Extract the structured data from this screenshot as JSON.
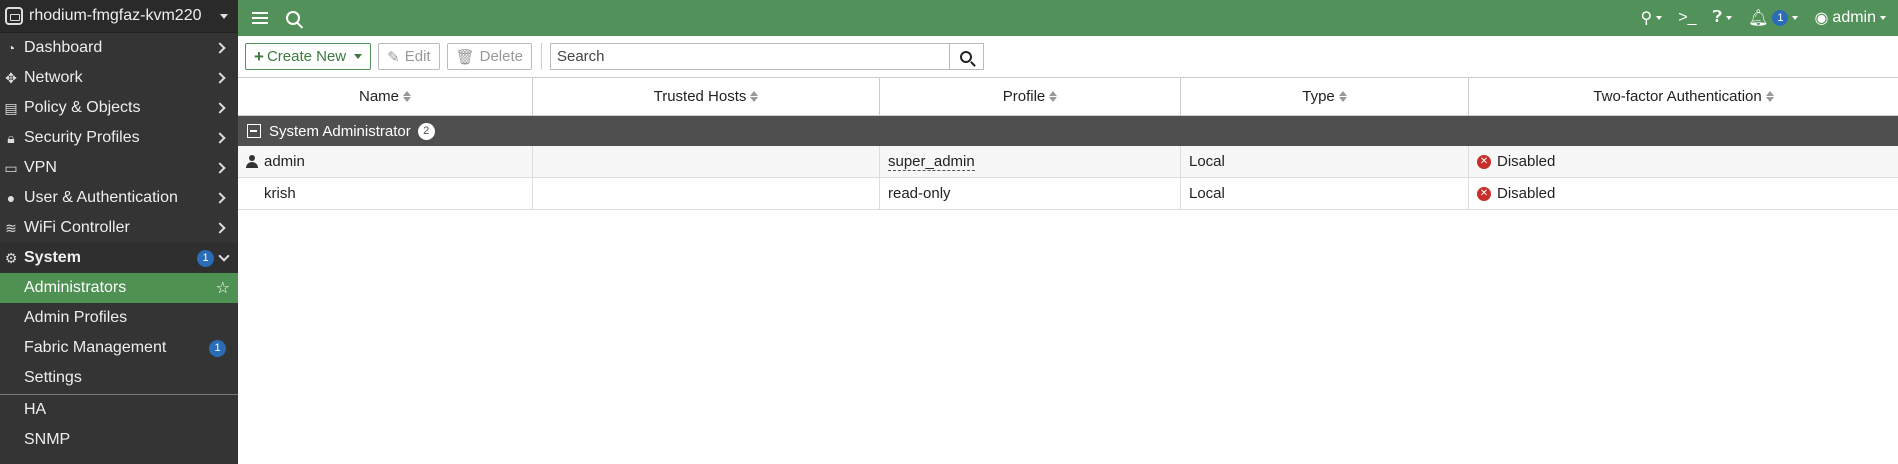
{
  "device": {
    "name": "rhodium-fmgfaz-kvm220"
  },
  "sidebar": {
    "items": [
      {
        "label": "Dashboard",
        "icon": "dashboard-icon"
      },
      {
        "label": "Network",
        "icon": "network-icon"
      },
      {
        "label": "Policy & Objects",
        "icon": "policy-icon"
      },
      {
        "label": "Security Profiles",
        "icon": "lock-icon"
      },
      {
        "label": "VPN",
        "icon": "laptop-icon"
      },
      {
        "label": "User & Authentication",
        "icon": "user-icon"
      },
      {
        "label": "WiFi Controller",
        "icon": "wifi-icon"
      }
    ],
    "system": {
      "label": "System",
      "badge": "1"
    },
    "sub_items": [
      {
        "label": "Administrators"
      },
      {
        "label": "Admin Profiles"
      },
      {
        "label": "Fabric Management",
        "badge": "1"
      },
      {
        "label": "Settings"
      }
    ],
    "sub_items_2": [
      {
        "label": "HA"
      },
      {
        "label": "SNMP"
      }
    ]
  },
  "topbar": {
    "notif_badge": "1",
    "user": "admin"
  },
  "toolbar": {
    "create_label": "Create New",
    "edit_label": "Edit",
    "delete_label": "Delete",
    "search_placeholder": "Search"
  },
  "table": {
    "columns": [
      "Name",
      "Trusted Hosts",
      "Profile",
      "Type",
      "Two-factor Authentication"
    ],
    "group": {
      "label": "System Administrator",
      "count": "2"
    },
    "rows": [
      {
        "name": "admin",
        "trusted": "",
        "profile": "super_admin",
        "type": "Local",
        "twofa": "Disabled"
      },
      {
        "name": "krish",
        "trusted": "",
        "profile": "read-only",
        "type": "Local",
        "twofa": "Disabled"
      }
    ]
  },
  "colors": {
    "accent": "#52925a",
    "badge": "#2a6cb5",
    "disabled": "#c9302c"
  }
}
